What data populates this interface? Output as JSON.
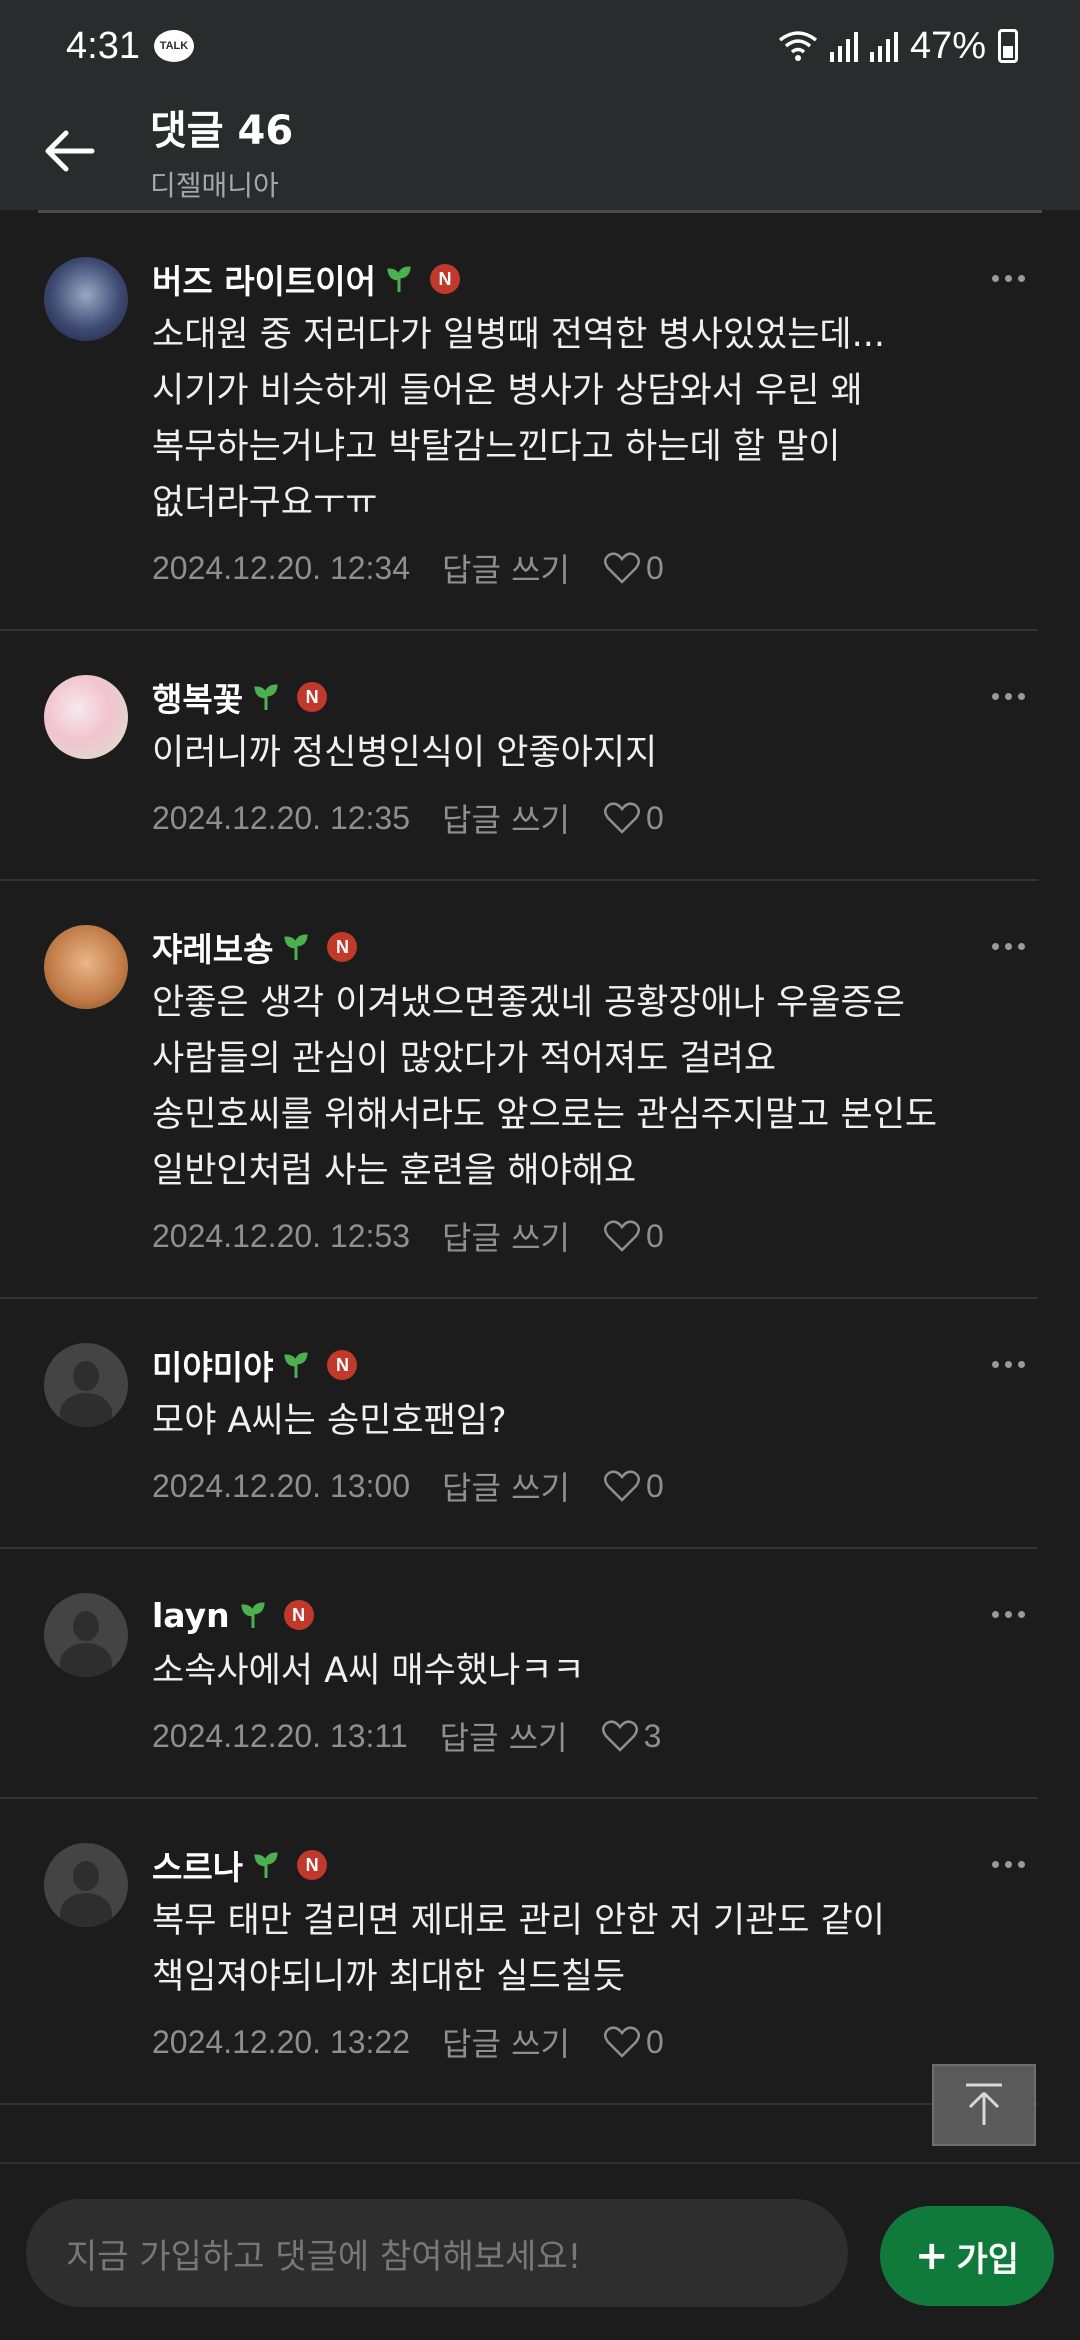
{
  "status_bar": {
    "time": "4:31",
    "talk_label": "TALK",
    "battery": "47%"
  },
  "header": {
    "title": "댓글 46",
    "subtitle": "디젤매니아"
  },
  "comments": [
    {
      "nickname": "버즈 라이트이어",
      "badge": "N",
      "text": "소대원 중 저러다가 일병때 전역한 병사있었는데...\n시기가 비슷하게 들어온 병사가 상담와서 우린 왜\n복무하는거냐고 박탈감느낀다고 하는데 할 말이\n없더라구요ㅜㅠ",
      "date": "2024.12.20. 12:34",
      "reply_label": "답글 쓰기",
      "likes": "0"
    },
    {
      "nickname": "행복꽃",
      "badge": "N",
      "text": "이러니까 정신병인식이 안좋아지지",
      "date": "2024.12.20. 12:35",
      "reply_label": "답글 쓰기",
      "likes": "0"
    },
    {
      "nickname": "쟈레보숑",
      "badge": "N",
      "text": "안좋은 생각 이겨냈으면좋겠네 공황장애나 우울증은\n사람들의 관심이 많았다가 적어져도 걸려요\n송민호씨를 위해서라도 앞으로는 관심주지말고 본인도\n일반인처럼 사는 훈련을 해야해요",
      "date": "2024.12.20. 12:53",
      "reply_label": "답글 쓰기",
      "likes": "0"
    },
    {
      "nickname": "미야미야",
      "badge": "N",
      "text": "모야 A씨는 송민호팬임?",
      "date": "2024.12.20. 13:00",
      "reply_label": "답글 쓰기",
      "likes": "0"
    },
    {
      "nickname": "layn",
      "badge": "N",
      "text": "소속사에서 A씨 매수했나ㅋㅋ",
      "date": "2024.12.20. 13:11",
      "reply_label": "답글 쓰기",
      "likes": "3"
    },
    {
      "nickname": "스르나",
      "badge": "N",
      "text": "복무 태만 걸리면 제대로 관리 안한 저 기관도 같이\n책임져야되니까 최대한 실드칠듯",
      "date": "2024.12.20. 13:22",
      "reply_label": "답글 쓰기",
      "likes": "0"
    }
  ],
  "bottom_bar": {
    "input_placeholder": "지금 가입하고 댓글에 참여해보세요!",
    "join_label": "가입",
    "join_plus": "+"
  },
  "colors": {
    "background": "#1c1c1c",
    "header": "#2a2b2c",
    "join_button": "#0f7a3a",
    "badge": "#c0392b",
    "sprout": "#4caf50"
  }
}
